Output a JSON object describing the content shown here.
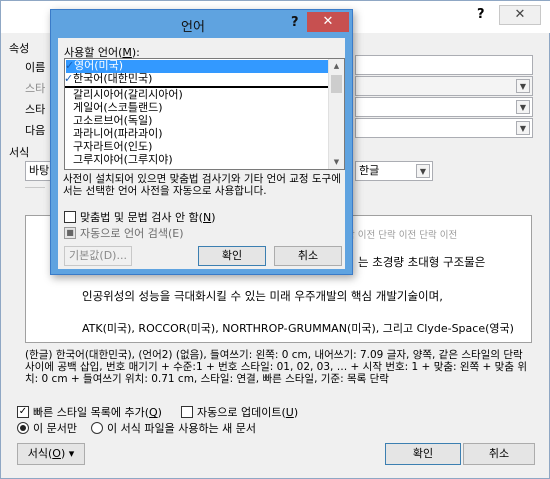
{
  "background": {
    "help": "?",
    "close": "✕",
    "section_properties": "속성",
    "name_label": "이름",
    "style_type_label": "스타",
    "style_base_label": "스타",
    "next_style_label": "다음",
    "section_format": "서식",
    "font_combo": "바탕",
    "lang_combo": "한글",
    "preview_top_text": "락 이전 단락 이전 단락 이전",
    "preview_line1": "는 초경량 초대형 구조물은",
    "preview_line2": "인공위성의 성능을 극대화시킬 수 있는 미래 우주개발의 핵심 개발기술이며,",
    "preview_line3": "ATK(미국), ROCCOR(미국), NORTHROP-GRUMMAN(미국), 그리고 Clyde-Space(영국)",
    "description": "(한글) 한국어(대한민국), (언어2) (없음), 들여쓰기: 왼쪽: 0 cm, 내어쓰기: 7.09 글자, 양쪽, 같은 스타일의 단락 사이에 공백 삽입, 번호 매기기 + 수준:1 + 번호 스타일: 01, 02, 03, … + 시작 번호: 1 + 맞춤: 왼쪽 + 맞춤 위치: 0 cm + 들여쓰기 위치: 0.71 cm, 스타일: 연결, 빠른 스타일, 기준: 목록 단락",
    "add_quick_style": "빠른 스타일 목록에 추가(",
    "add_quick_style_key": "Q",
    "add_quick_style_end": ")",
    "auto_update": "자동으로 업데이트(",
    "auto_update_key": "U",
    "auto_update_end": ")",
    "this_doc_only": "이 문서만",
    "new_docs": "이 서식 파일을 사용하는 새 문서",
    "format_button": "서식(",
    "format_key": "O",
    "format_end": ") ▾",
    "ok_button": "확인",
    "cancel_button": "취소"
  },
  "language_dialog": {
    "title": "언어",
    "help": "?",
    "close": "✕",
    "list_label": "사용할 언어(",
    "list_label_key": "M",
    "list_label_end": "):",
    "languages": [
      {
        "label": "영어(미국)",
        "checked": true,
        "selected": true
      },
      {
        "label": "한국어(대한민국)",
        "checked": true,
        "selected": false
      },
      {
        "label": "갈리시아어(갈리시아어)",
        "checked": false,
        "selected": false
      },
      {
        "label": "게일어(스코틀랜드)",
        "checked": false,
        "selected": false
      },
      {
        "label": "고소르브어(독일)",
        "checked": false,
        "selected": false
      },
      {
        "label": "과라니어(파라과이)",
        "checked": false,
        "selected": false
      },
      {
        "label": "구자라트어(인도)",
        "checked": false,
        "selected": false
      },
      {
        "label": "그루지야어(그루지야)",
        "checked": false,
        "selected": false
      }
    ],
    "info_text": "사전이 설치되어 있으면 맞춤법 검사기와 기타 언어 교정 도구에서는 선택한 언어 사전을 자동으로 사용합니다.",
    "no_spell_check": "맞춤법 및 문법 검사 안 함(",
    "no_spell_check_key": "N",
    "no_spell_check_end": ")",
    "auto_detect": "자동으로 언어 검색(E)",
    "default_button": "기본값(D)...",
    "ok_button": "확인",
    "cancel_button": "취소"
  }
}
